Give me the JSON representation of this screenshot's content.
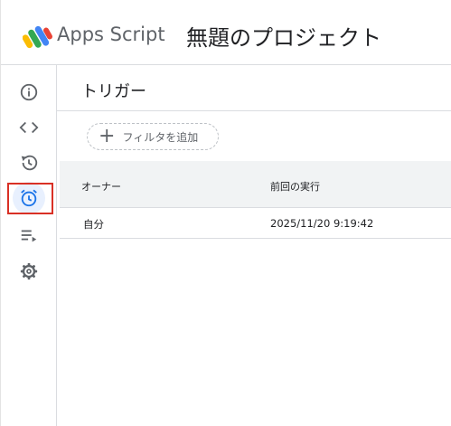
{
  "header": {
    "app_name": "Apps Script",
    "project_name": "無題のプロジェクト"
  },
  "rail": {
    "items": [
      {
        "icon": "info-icon"
      },
      {
        "icon": "code-icon"
      },
      {
        "icon": "history-icon"
      },
      {
        "icon": "alarm-clock-icon",
        "active": true
      },
      {
        "icon": "executions-icon"
      },
      {
        "icon": "gear-icon"
      }
    ],
    "accent_color": "#1a73e8",
    "highlight_color": "#d93025"
  },
  "main": {
    "title": "トリガー",
    "filter_label": "フィルタを追加",
    "table": {
      "columns": [
        "オーナー",
        "前回の実行"
      ],
      "rows": [
        [
          "自分",
          "2025/11/20 9:19:42"
        ]
      ]
    }
  }
}
